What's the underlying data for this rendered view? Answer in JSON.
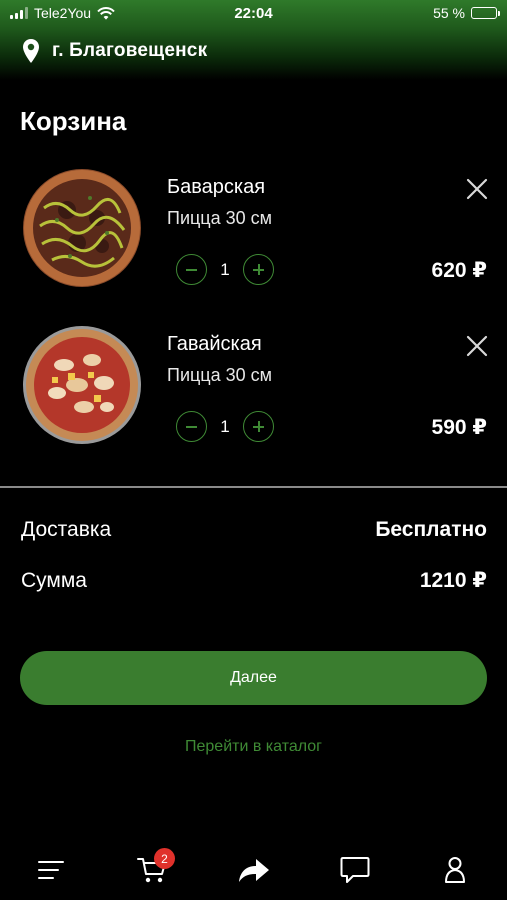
{
  "status_bar": {
    "carrier": "Tele2You",
    "time": "22:04",
    "battery_percent_text": "55 %",
    "battery_level": 0.55
  },
  "header": {
    "city": "г. Благовещенск",
    "icon": "location-pin-icon"
  },
  "page_title": "Корзина",
  "cart": {
    "items": [
      {
        "name": "Баварская",
        "description": "Пицца 30 см",
        "quantity": "1",
        "price": "620 ₽"
      },
      {
        "name": "Гавайская",
        "description": "Пицца 30 см",
        "quantity": "1",
        "price": "590 ₽"
      }
    ]
  },
  "summary": {
    "delivery_label": "Доставка",
    "delivery_value": "Бесплатно",
    "total_label": "Сумма",
    "total_value": "1210 ₽"
  },
  "actions": {
    "next_label": "Далее",
    "catalog_link": "Перейти в каталог"
  },
  "tab_bar": {
    "cart_badge": "2",
    "icons": [
      "menu-icon",
      "cart-icon",
      "share-icon",
      "chat-icon",
      "profile-icon"
    ]
  },
  "colors": {
    "accent": "#3a7d2f",
    "accent_text": "#3f8a35",
    "badge": "#e0312b",
    "background": "#000000"
  }
}
